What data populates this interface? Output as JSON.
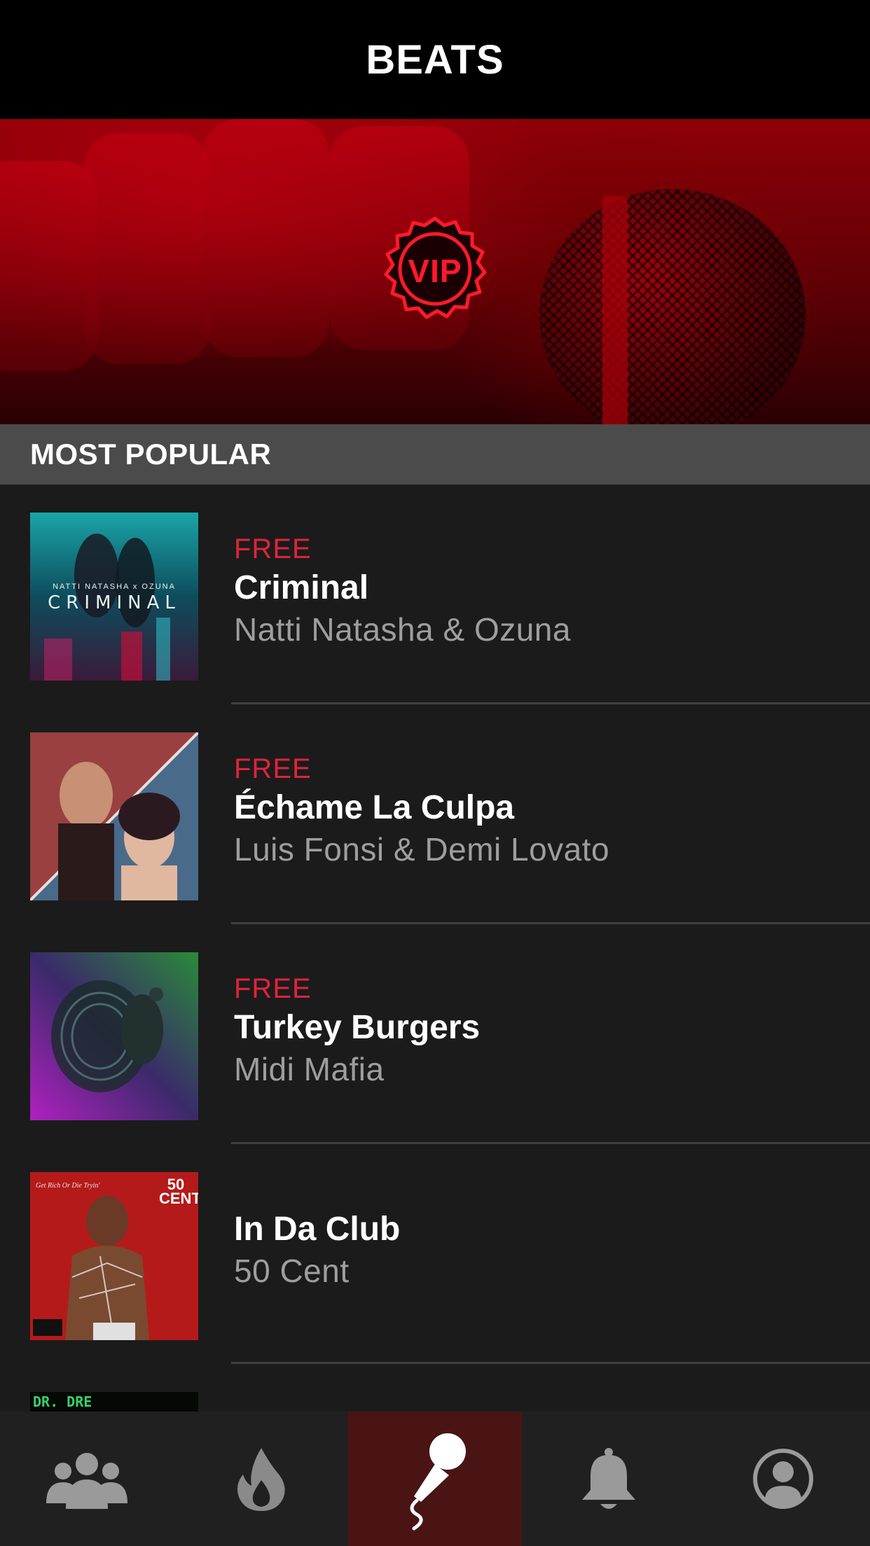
{
  "header": {
    "title": "BEATS"
  },
  "banner": {
    "badge_text": "VIP"
  },
  "section": {
    "title": "MOST POPULAR"
  },
  "songs": [
    {
      "tag": "FREE",
      "title": "Criminal",
      "artist": "Natti Natasha & Ozuna"
    },
    {
      "tag": "FREE",
      "title": "Échame La Culpa",
      "artist": "Luis Fonsi & Demi Lovato"
    },
    {
      "tag": "FREE",
      "title": "Turkey Burgers",
      "artist": "Midi Mafia"
    },
    {
      "tag": "",
      "title": "In Da Club",
      "artist": "50 Cent"
    }
  ],
  "album_art": {
    "criminal": {
      "line1": "NATTI NATASHA x OZUNA",
      "line2": "CRIMINAL"
    },
    "in_da_club": {
      "badge": "50\nCENT",
      "caption": "Get Rich Or Die Tryin'"
    },
    "partial": {
      "label": "DR. DRE"
    }
  },
  "tabs": [
    {
      "icon": "group-icon",
      "active": false
    },
    {
      "icon": "flame-icon",
      "active": false
    },
    {
      "icon": "microphone-icon",
      "active": true
    },
    {
      "icon": "bell-icon",
      "active": false
    },
    {
      "icon": "profile-icon",
      "active": false
    }
  ],
  "colors": {
    "accent": "#e0233c",
    "header_bg": "#000000",
    "list_bg": "#1b1b1b",
    "section_bg": "#4b4b4b",
    "active_tab": "#4a1414"
  }
}
